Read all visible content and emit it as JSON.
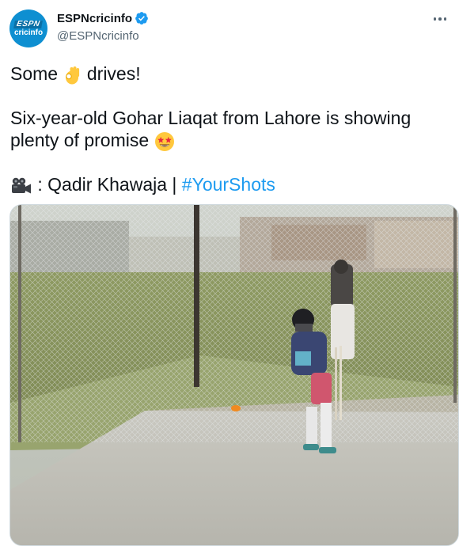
{
  "account": {
    "display_name": "ESPNcricinfo",
    "handle": "@ESPNcricinfo",
    "verified": true,
    "avatar_brand_top": "ESPN",
    "avatar_brand_bottom": "cricinfo",
    "avatar_color": "#0e8fd1"
  },
  "tweet": {
    "line1_pre": "Some ",
    "line1_emoji": "ok-hand-emoji",
    "line1_post": " drives!",
    "line2": "Six-year-old Gohar Liaqat from Lahore is showing",
    "line3": "plenty of promise ",
    "line3_emoji": "star-struck-emoji",
    "credit_icon": "movie-camera-emoji",
    "credit_text": ": Qadir Khawaja | ",
    "hashtag": "#YourShots",
    "hashtag_color": "#1d9bf0"
  },
  "media": {
    "type": "video",
    "scene": "child-batting-in-cricket-nets"
  },
  "more_icon": "more-options-icon",
  "verified_icon": "verified-badge-icon"
}
